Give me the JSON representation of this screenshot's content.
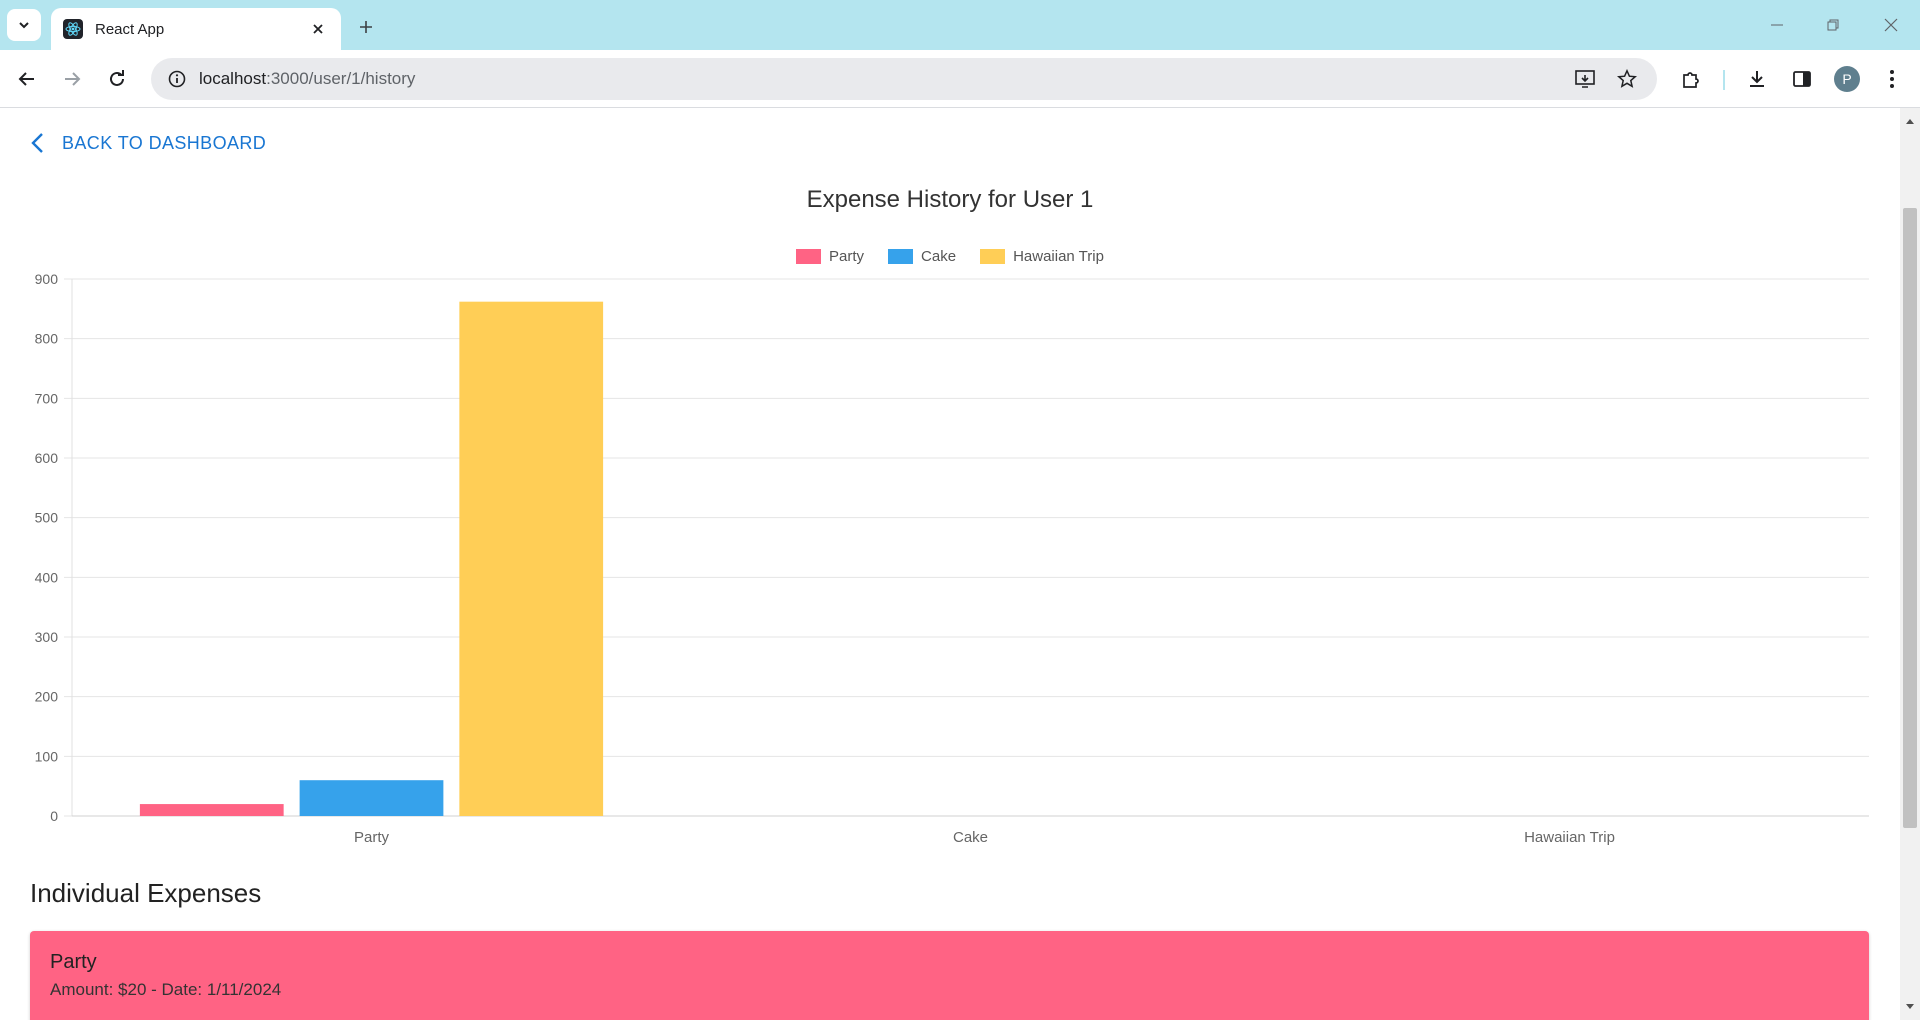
{
  "browser": {
    "tab_title": "React App",
    "url_host": "localhost",
    "url_path": ":3000/user/1/history",
    "avatar_letter": "P"
  },
  "page": {
    "back_label": "BACK TO DASHBOARD",
    "section_title": "Individual Expenses",
    "expenses": [
      {
        "name": "Party",
        "meta": "Amount: $20 - Date: 1/11/2024",
        "color": "#ff6384"
      }
    ]
  },
  "chart_data": {
    "type": "bar",
    "title": "Expense History for User 1",
    "categories": [
      "Party",
      "Cake",
      "Hawaiian Trip"
    ],
    "series": [
      {
        "name": "Party",
        "color": "#ff6384",
        "values": [
          20,
          0,
          0
        ]
      },
      {
        "name": "Cake",
        "color": "#36a2eb",
        "values": [
          60,
          0,
          0
        ]
      },
      {
        "name": "Hawaiian Trip",
        "color": "#ffce56",
        "values": [
          862,
          0,
          0
        ]
      }
    ],
    "ylim": [
      0,
      900
    ],
    "yticks": [
      0,
      100,
      200,
      300,
      400,
      500,
      600,
      700,
      800,
      900
    ],
    "grid": true,
    "legend": "top"
  }
}
